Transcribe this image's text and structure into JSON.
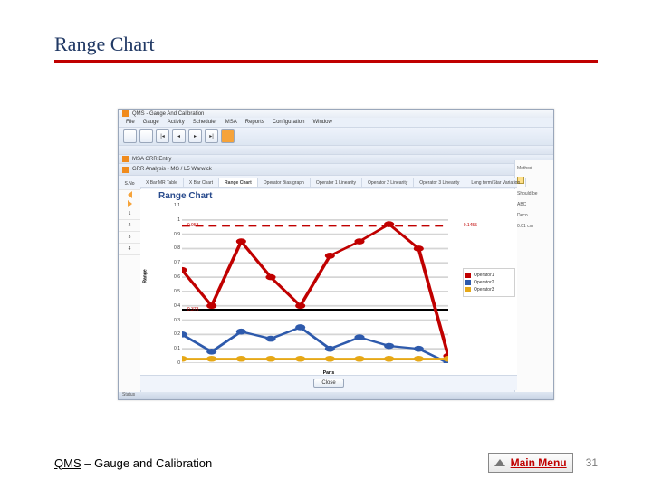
{
  "slide": {
    "title": "Range Chart",
    "footer_left_prefix": "QMS",
    "footer_left_suffix": " – Gauge and Calibration",
    "main_menu": "Main Menu",
    "page_number": "31"
  },
  "app": {
    "window_title": "QMS - Gauge And Calibration",
    "menu_items": [
      "File",
      "Gauge",
      "Activity",
      "Scheduler",
      "MSA",
      "Reports",
      "Configuration",
      "Window"
    ],
    "sub_window": "MSA GRR Entry",
    "grr_caption": "GRR Analysis - MG / L5 Warwick",
    "left_col_header": "S.No",
    "left_rows": [
      "1",
      "2",
      "3",
      "4"
    ],
    "tabs": [
      "X Bar MR Table",
      "X Bar Chart",
      "Range Chart",
      "Operator Bias graph",
      "Operator 1 Linearity",
      "Operator 2 Linearity",
      "Operator 3 Linearity",
      "Long term/Star Variation"
    ],
    "close": "Close",
    "status": "Status",
    "right": {
      "method": "Method",
      "should_be": "Should be",
      "abc": "ABC",
      "deco": "Deco",
      "coeff": "0.01 cm"
    }
  },
  "chart_data": {
    "type": "line",
    "title": "Range Chart",
    "xlabel": "Parts",
    "ylabel": "Range",
    "ylim": [
      0,
      1.1
    ],
    "yticks": [
      0,
      0.1,
      0.2,
      0.3,
      0.4,
      0.5,
      0.6,
      0.7,
      0.8,
      0.9,
      1.0,
      1.1
    ],
    "upper_limit": {
      "value": 0.958,
      "label": "0.958"
    },
    "center_line": {
      "value": 0.373,
      "label": "0.373"
    },
    "right_annotation": "0.1455",
    "series": [
      {
        "name": "Operator1",
        "color": "#c00000",
        "values": [
          0.65,
          0.4,
          0.85,
          0.6,
          0.4,
          0.75,
          0.85,
          0.97,
          0.8,
          0.05
        ]
      },
      {
        "name": "Operator2",
        "color": "#2e5aac",
        "values": [
          0.2,
          0.08,
          0.22,
          0.17,
          0.25,
          0.1,
          0.18,
          0.12,
          0.1,
          0.0
        ]
      },
      {
        "name": "Operator3",
        "color": "#e6a817",
        "values": [
          0.03,
          0.03,
          0.03,
          0.03,
          0.03,
          0.03,
          0.03,
          0.03,
          0.03,
          0.03
        ]
      }
    ]
  }
}
